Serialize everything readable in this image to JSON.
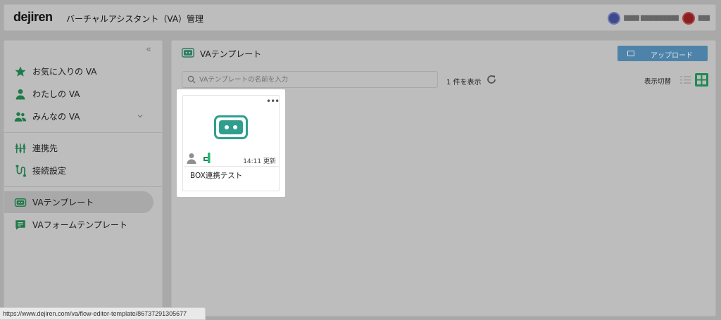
{
  "header": {
    "logo": "dejiren",
    "title": "バーチャルアシスタント（VA）管理"
  },
  "sidebar": {
    "items": [
      {
        "label": "お気に入りの VA",
        "icon": "star-icon"
      },
      {
        "label": "わたしの VA",
        "icon": "person-icon"
      },
      {
        "label": "みんなの VA",
        "icon": "people-icon"
      },
      {
        "label": "連携先",
        "icon": "connector-icon"
      },
      {
        "label": "接続設定",
        "icon": "connection-settings-icon"
      },
      {
        "label": "VAテンプレート",
        "icon": "robot-face-icon",
        "active": true
      },
      {
        "label": "VAフォームテンプレート",
        "icon": "form-icon"
      }
    ]
  },
  "main": {
    "title": "VAテンプレート",
    "upload_label": "アップロード",
    "search_placeholder": "VAテンプレートの名前を入力",
    "count_label": "1 件を表示",
    "view_toggle_label": "表示切替",
    "selected_view": "grid"
  },
  "card": {
    "updated": "14:11 更新",
    "name": "BOX連携テスト"
  },
  "statusbar": {
    "url": "https://www.dejiren.com/va/flow-editor-template/86737291305677"
  },
  "colors": {
    "accent_green": "#2f9e8f",
    "brand_green": "#1f8a52",
    "upload_blue": "#4d83a8"
  }
}
